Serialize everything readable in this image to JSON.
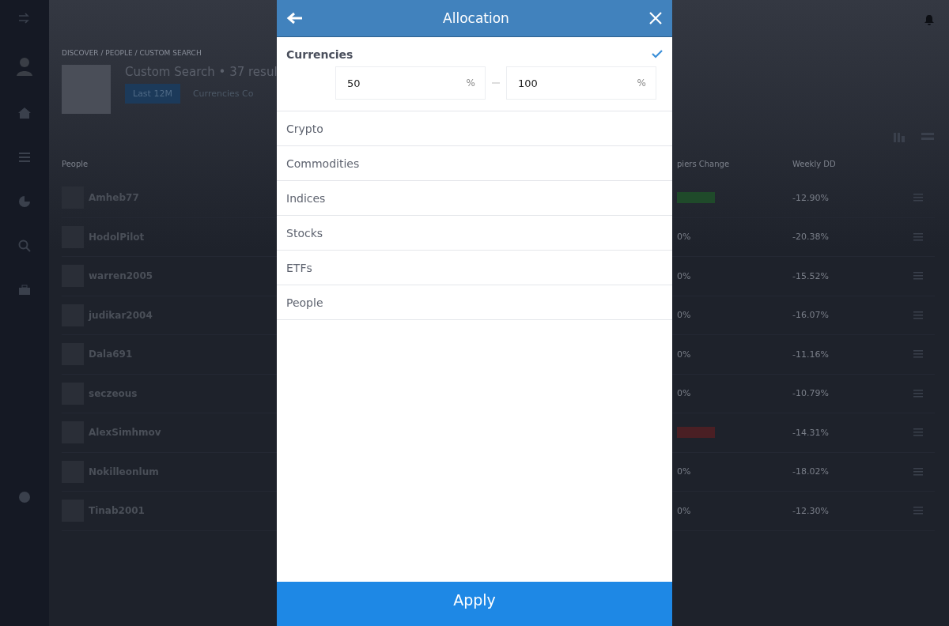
{
  "background": {
    "breadcrumb": "DISCOVER / PEOPLE / CUSTOM SEARCH",
    "title": "Custom Search • 37 resul",
    "period_button": "Last 12M",
    "filter_link": "Currencies Co",
    "columns": [
      "People",
      "piers Change",
      "Weekly DD"
    ],
    "rows": [
      {
        "name": "Amheb77",
        "color": "#1f4a2a",
        "dd": "-12.90%"
      },
      {
        "name": "HodolPilot",
        "change": "0%",
        "dd": "-20.38%"
      },
      {
        "name": "warren2005",
        "change": "0%",
        "dd": "-15.52%"
      },
      {
        "name": "judikar2004",
        "change": "0%",
        "dd": "-16.07%"
      },
      {
        "name": "Dala691",
        "change": "0%",
        "dd": "-11.16%"
      },
      {
        "name": "seczeous",
        "change": "0%",
        "dd": "-10.79%"
      },
      {
        "name": "AlexSimhmov",
        "color": "#4a1f24",
        "dd": "-14.31%"
      },
      {
        "name": "Nokilleonlum",
        "change": "0%",
        "dd": "-18.02%"
      },
      {
        "name": "Tinab2001",
        "change": "0%",
        "dd": "-12.30%"
      }
    ]
  },
  "dialog": {
    "title": "Allocation",
    "items": [
      {
        "label": "Currencies",
        "checked": true,
        "expanded": true,
        "from": "50",
        "to": "100",
        "unit": "%"
      },
      {
        "label": "Crypto",
        "checked": false,
        "expanded": false
      },
      {
        "label": "Commodities",
        "checked": false,
        "expanded": false
      },
      {
        "label": "Indices",
        "checked": false,
        "expanded": false
      },
      {
        "label": "Stocks",
        "checked": false,
        "expanded": false
      },
      {
        "label": "ETFs",
        "checked": false,
        "expanded": false
      },
      {
        "label": "People",
        "checked": false,
        "expanded": false
      }
    ],
    "apply": "Apply"
  }
}
